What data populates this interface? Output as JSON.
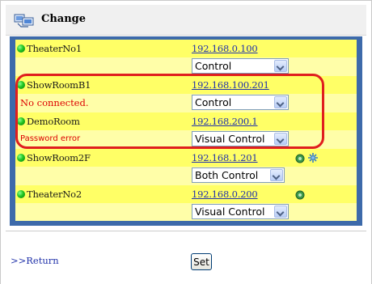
{
  "header": {
    "title": "Change"
  },
  "devices": [
    {
      "name": "TheaterNo1",
      "ip": "192.168.0.100",
      "status": "",
      "control": "Control"
    },
    {
      "name": "ShowRoomB1",
      "ip": "192.168.100.201",
      "status": "No connected.",
      "control": "Control"
    },
    {
      "name": "DemoRoom",
      "ip": "192.168.200.1",
      "status": "Password error",
      "control": "Visual Control"
    },
    {
      "name": "ShowRoom2F",
      "ip": "192.168.1.201",
      "status": "",
      "control": "Both Control"
    },
    {
      "name": "TheaterNo2",
      "ip": "192.168.0.200",
      "status": "",
      "control": "Visual Control"
    }
  ],
  "footer": {
    "return_label": ">>Return",
    "set_label": "Set"
  },
  "colors": {
    "panel_border": "#3d6aaa",
    "name_row": "#ffff66",
    "select_row": "#fffea8",
    "status_error": "#dd0000",
    "link": "#2233aa",
    "highlight": "#e01e1e"
  }
}
